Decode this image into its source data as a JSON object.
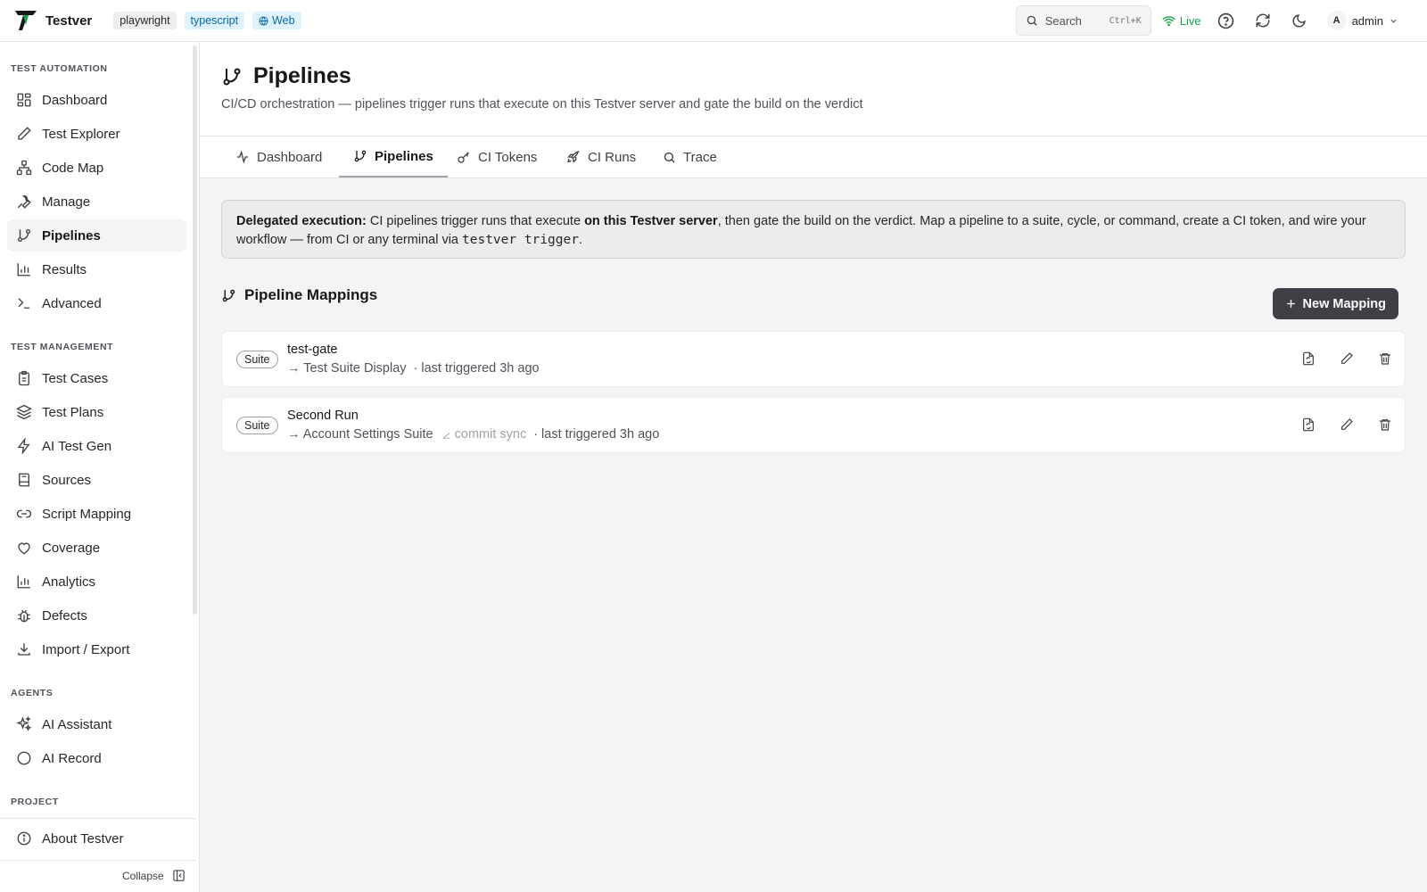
{
  "app": {
    "name": "Testver",
    "tags": [
      "playwright",
      "typescript"
    ],
    "web_tag": "Web"
  },
  "topbar": {
    "search_label": "Search",
    "search_shortcut": "Ctrl+K",
    "live_label": "Live",
    "user_initial": "A",
    "user_name": "admin"
  },
  "sidebar": {
    "sections": [
      {
        "title": "TEST AUTOMATION",
        "items": [
          {
            "label": "Dashboard",
            "icon": "grid-icon"
          },
          {
            "label": "Test Explorer",
            "icon": "pencil-icon"
          },
          {
            "label": "Code Map",
            "icon": "network-icon"
          },
          {
            "label": "Manage",
            "icon": "wrench-icon"
          },
          {
            "label": "Pipelines",
            "icon": "git-branch-icon",
            "active": true
          },
          {
            "label": "Results",
            "icon": "bar-chart-icon"
          },
          {
            "label": "Advanced",
            "icon": "terminal-icon"
          }
        ]
      },
      {
        "title": "TEST MANAGEMENT",
        "items": [
          {
            "label": "Test Cases",
            "icon": "clipboard-icon"
          },
          {
            "label": "Test Plans",
            "icon": "layers-icon"
          },
          {
            "label": "AI Test Gen",
            "icon": "bolt-icon"
          },
          {
            "label": "Sources",
            "icon": "book-icon"
          },
          {
            "label": "Script Mapping",
            "icon": "link-icon"
          },
          {
            "label": "Coverage",
            "icon": "heart-icon"
          },
          {
            "label": "Analytics",
            "icon": "bar-chart-icon"
          },
          {
            "label": "Defects",
            "icon": "bug-icon"
          },
          {
            "label": "Import / Export",
            "icon": "download-icon"
          }
        ]
      },
      {
        "title": "AGENTS",
        "items": [
          {
            "label": "AI Assistant",
            "icon": "sparkles-icon"
          },
          {
            "label": "AI Record",
            "icon": "circle-icon"
          }
        ]
      },
      {
        "title": "PROJECT",
        "items": [
          {
            "label": "About Testver",
            "icon": "info-icon"
          }
        ]
      }
    ],
    "collapse_label": "Collapse"
  },
  "page": {
    "title": "Pipelines",
    "subtitle": "CI/CD orchestration — pipelines trigger runs that execute on this Testver server and gate the build on the verdict"
  },
  "tabs": [
    {
      "label": "Dashboard",
      "icon": "activity-icon"
    },
    {
      "label": "Pipelines",
      "icon": "git-branch-icon",
      "active": true
    },
    {
      "label": "CI Tokens",
      "icon": "key-icon"
    },
    {
      "label": "CI Runs",
      "icon": "rocket-icon"
    },
    {
      "label": "Trace",
      "icon": "search-icon"
    }
  ],
  "notice": {
    "lead": "Delegated execution:",
    "text1": " CI pipelines trigger runs that execute ",
    "strong": "on this Testver server",
    "text2": ", then gate the build on the verdict. Map a pipeline to a suite, cycle, or command, create a CI token, and wire your workflow — from CI or any terminal via ",
    "code": "testver trigger",
    "text3": "."
  },
  "mappings_section": {
    "title": "Pipeline Mappings",
    "new_button": "New Mapping"
  },
  "mappings": [
    {
      "badge": "Suite",
      "name": "test-gate",
      "target": "→ Test Suite Display",
      "sync": "",
      "triggered": "· last triggered 3h ago"
    },
    {
      "badge": "Suite",
      "name": "Second Run",
      "target": "→ Account Settings Suite",
      "sync": "commit sync",
      "triggered": "· last triggered 3h ago"
    }
  ]
}
